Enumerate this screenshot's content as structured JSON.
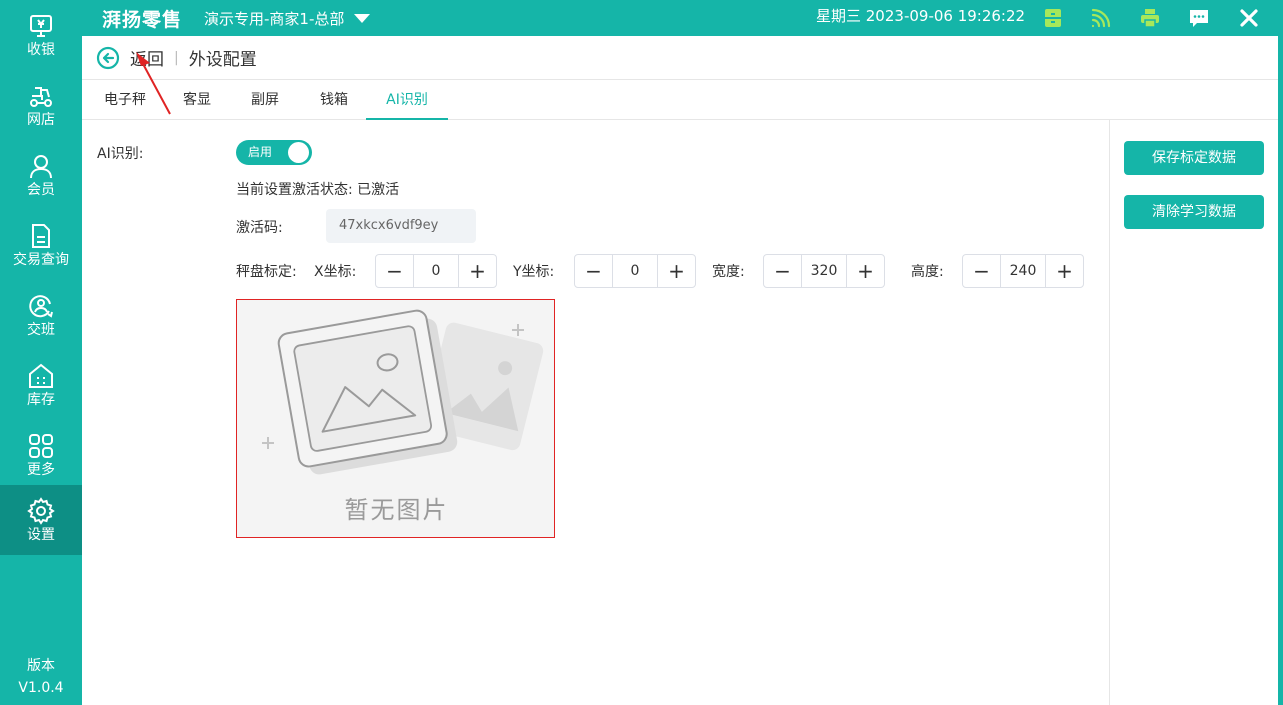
{
  "app": {
    "brand": "湃扬零售",
    "store": "演示专用-商家1-总部",
    "datetime": "星期三 2023-09-06 19:26:22",
    "version_label": "版本",
    "version": "V1.0.4"
  },
  "sidebar": {
    "items": [
      {
        "label": "收银",
        "icon": "cashier-icon"
      },
      {
        "label": "网店",
        "icon": "scooter-icon"
      },
      {
        "label": "会员",
        "icon": "member-icon"
      },
      {
        "label": "交易查询",
        "icon": "document-icon"
      },
      {
        "label": "交班",
        "icon": "shift-icon"
      },
      {
        "label": "库存",
        "icon": "warehouse-icon"
      },
      {
        "label": "更多",
        "icon": "grid-icon"
      },
      {
        "label": "设置",
        "icon": "gear-icon"
      }
    ],
    "active": "设置"
  },
  "header": {
    "back": "返回",
    "separator": "|",
    "title": "外设配置"
  },
  "tabs": [
    {
      "label": "电子秤"
    },
    {
      "label": "客显"
    },
    {
      "label": "副屏"
    },
    {
      "label": "钱箱"
    },
    {
      "label": "AI识别",
      "active": true
    }
  ],
  "ai": {
    "label": "AI识别:",
    "toggle_text": "启用",
    "status": "当前设置激活状态: 已激活",
    "code_label": "激活码:",
    "code": "47xkcx6vdf9ey",
    "calib_label": "秤盘标定:",
    "x_label": "X坐标:",
    "x_value": "0",
    "y_label": "Y坐标:",
    "y_value": "0",
    "w_label": "宽度:",
    "w_value": "320",
    "h_label": "高度:",
    "h_value": "240",
    "no_image": "暂无图片",
    "minus": "−",
    "plus": "+"
  },
  "actions": {
    "save": "保存标定数据",
    "clear": "清除学习数据"
  },
  "colors": {
    "primary": "#15b5a8",
    "active_nav": "#0d8f85",
    "frame_border": "#e02424"
  }
}
